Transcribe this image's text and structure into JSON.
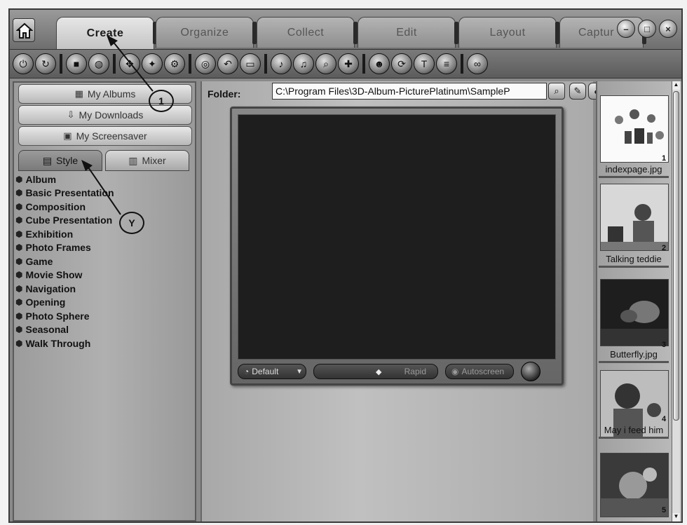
{
  "tabs": [
    {
      "label": "Create",
      "active": true
    },
    {
      "label": "Organize",
      "active": false
    },
    {
      "label": "Collect",
      "active": false
    },
    {
      "label": "Edit",
      "active": false
    },
    {
      "label": "Layout",
      "active": false
    },
    {
      "label": "Captur",
      "active": false
    }
  ],
  "toolbar_groups": [
    [
      "power-icon",
      "refresh-icon"
    ],
    [
      "stop-icon",
      "globe-icon"
    ],
    [
      "move-icon",
      "magic-icon",
      "settings-icon"
    ],
    [
      "disc-icon",
      "undo-icon",
      "folder-icon"
    ],
    [
      "music-icon",
      "music-alt-icon",
      "search-icon",
      "puzzle-icon"
    ],
    [
      "person-icon",
      "rotate-icon",
      "text-icon",
      "list-icon"
    ],
    [
      "link-icon"
    ]
  ],
  "left_nav": {
    "my_albums": "My Albums",
    "my_downloads": "My Downloads",
    "my_screensaver": "My Screensaver",
    "style_tab": "Style",
    "mixer_tab": "Mixer"
  },
  "style_items": [
    "Album",
    "Basic Presentation",
    "Composition",
    "Cube Presentation",
    "Exhibition",
    "Photo Frames",
    "Game",
    "Movie Show",
    "Navigation",
    "Opening",
    "Photo Sphere",
    "Seasonal",
    "Walk Through"
  ],
  "folder": {
    "label": "Folder:",
    "path": "C:\\Program Files\\3D-Album-PicturePlatinum\\SampleP"
  },
  "preview": {
    "mode": "Default",
    "speed": "Rapid",
    "auto": "Autoscreen"
  },
  "thumbnails": [
    {
      "num": "1",
      "label": "indexpage.jpg"
    },
    {
      "num": "2",
      "label": "Talking teddie"
    },
    {
      "num": "3",
      "label": "Butterfly.jpg"
    },
    {
      "num": "4",
      "label": "May i feed him"
    },
    {
      "num": "5",
      "label": ""
    }
  ],
  "callouts": [
    "1",
    "Y"
  ]
}
